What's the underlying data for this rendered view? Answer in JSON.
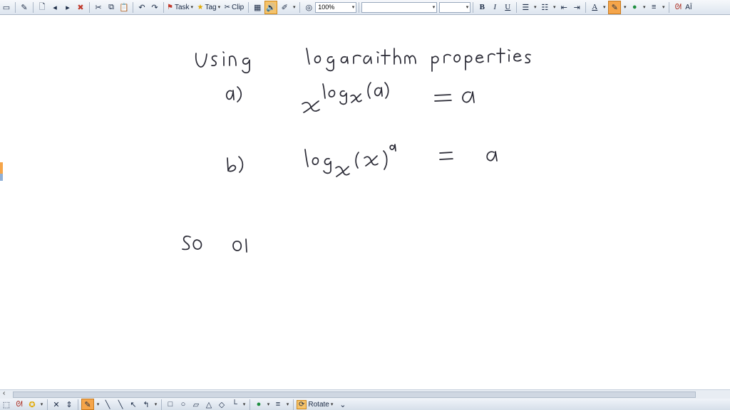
{
  "toolbar": {
    "task_label": "Task",
    "tag_label": "Tag",
    "clip_label": "Clip",
    "zoom_value": "100%",
    "font_family_value": "",
    "font_size_value": "",
    "bold_label": "B",
    "italic_label": "I",
    "underline_label": "U",
    "font_color_label": "A",
    "text_size_label": "AĪ"
  },
  "bottom_toolbar": {
    "rotate_label": "Rotate"
  },
  "colors": {
    "highlight": "#f5a54a",
    "ink": "#2a2a35",
    "toolbar_bg": "#dde5ef"
  }
}
